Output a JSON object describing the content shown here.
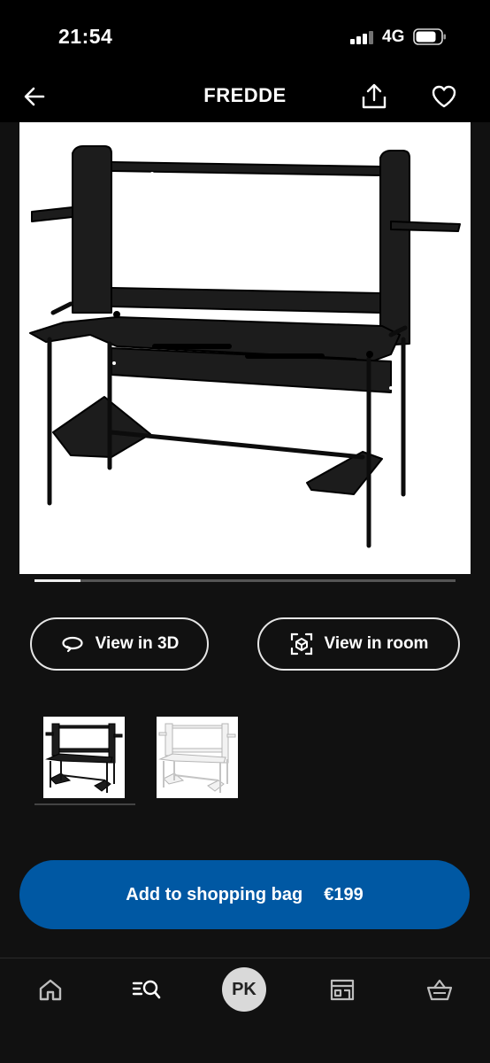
{
  "status_bar": {
    "time": "21:54",
    "network": "4G",
    "icons": [
      "signal-icon",
      "battery-icon"
    ]
  },
  "header": {
    "title": "FREDDE",
    "icons": [
      "back-arrow-icon",
      "share-icon",
      "heart-icon"
    ]
  },
  "gallery": {
    "image_subject": "black gaming desk with shelves",
    "position_fraction": 0.11
  },
  "actions": {
    "view_3d_label": "View in 3D",
    "view_room_label": "View in room",
    "icons": [
      "rotate-3d-icon",
      "ar-cube-icon"
    ]
  },
  "variants": {
    "items": [
      "black",
      "white"
    ],
    "selected": "black"
  },
  "purchase": {
    "button_label": "Add to shopping bag",
    "price": "€199"
  },
  "tab_bar": {
    "avatar_initials": "PK",
    "tabs": [
      "home-icon",
      "search-icon",
      "profile-avatar",
      "store-icon",
      "basket-icon"
    ]
  },
  "colors": {
    "background": "#111111",
    "header": "#000000",
    "accent_blue": "#0058a3",
    "avatar_bg": "#d9d9d9"
  }
}
